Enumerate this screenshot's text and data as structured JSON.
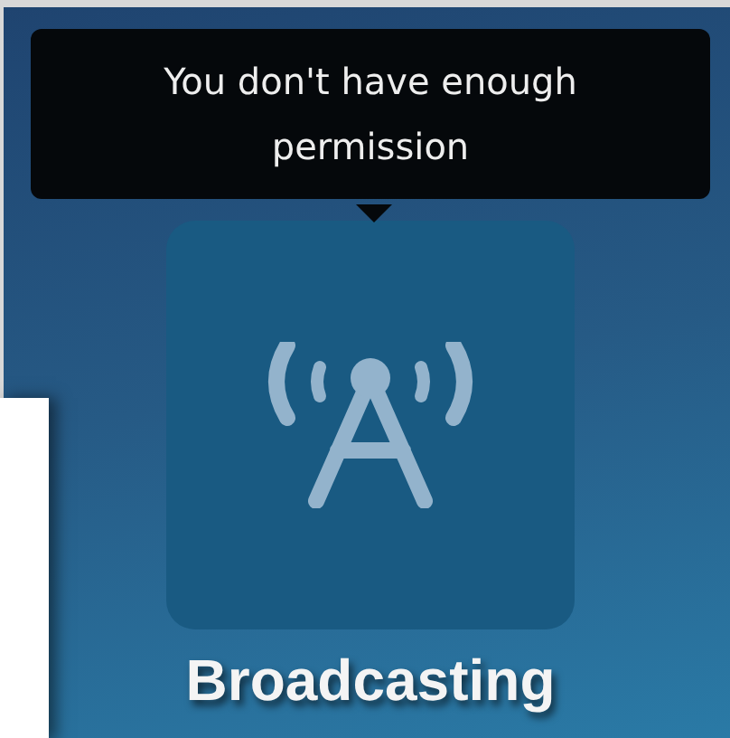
{
  "tooltip": {
    "text": "You don't have enough permission"
  },
  "app_tile": {
    "label": "Broadcasting",
    "disabled": true
  }
}
